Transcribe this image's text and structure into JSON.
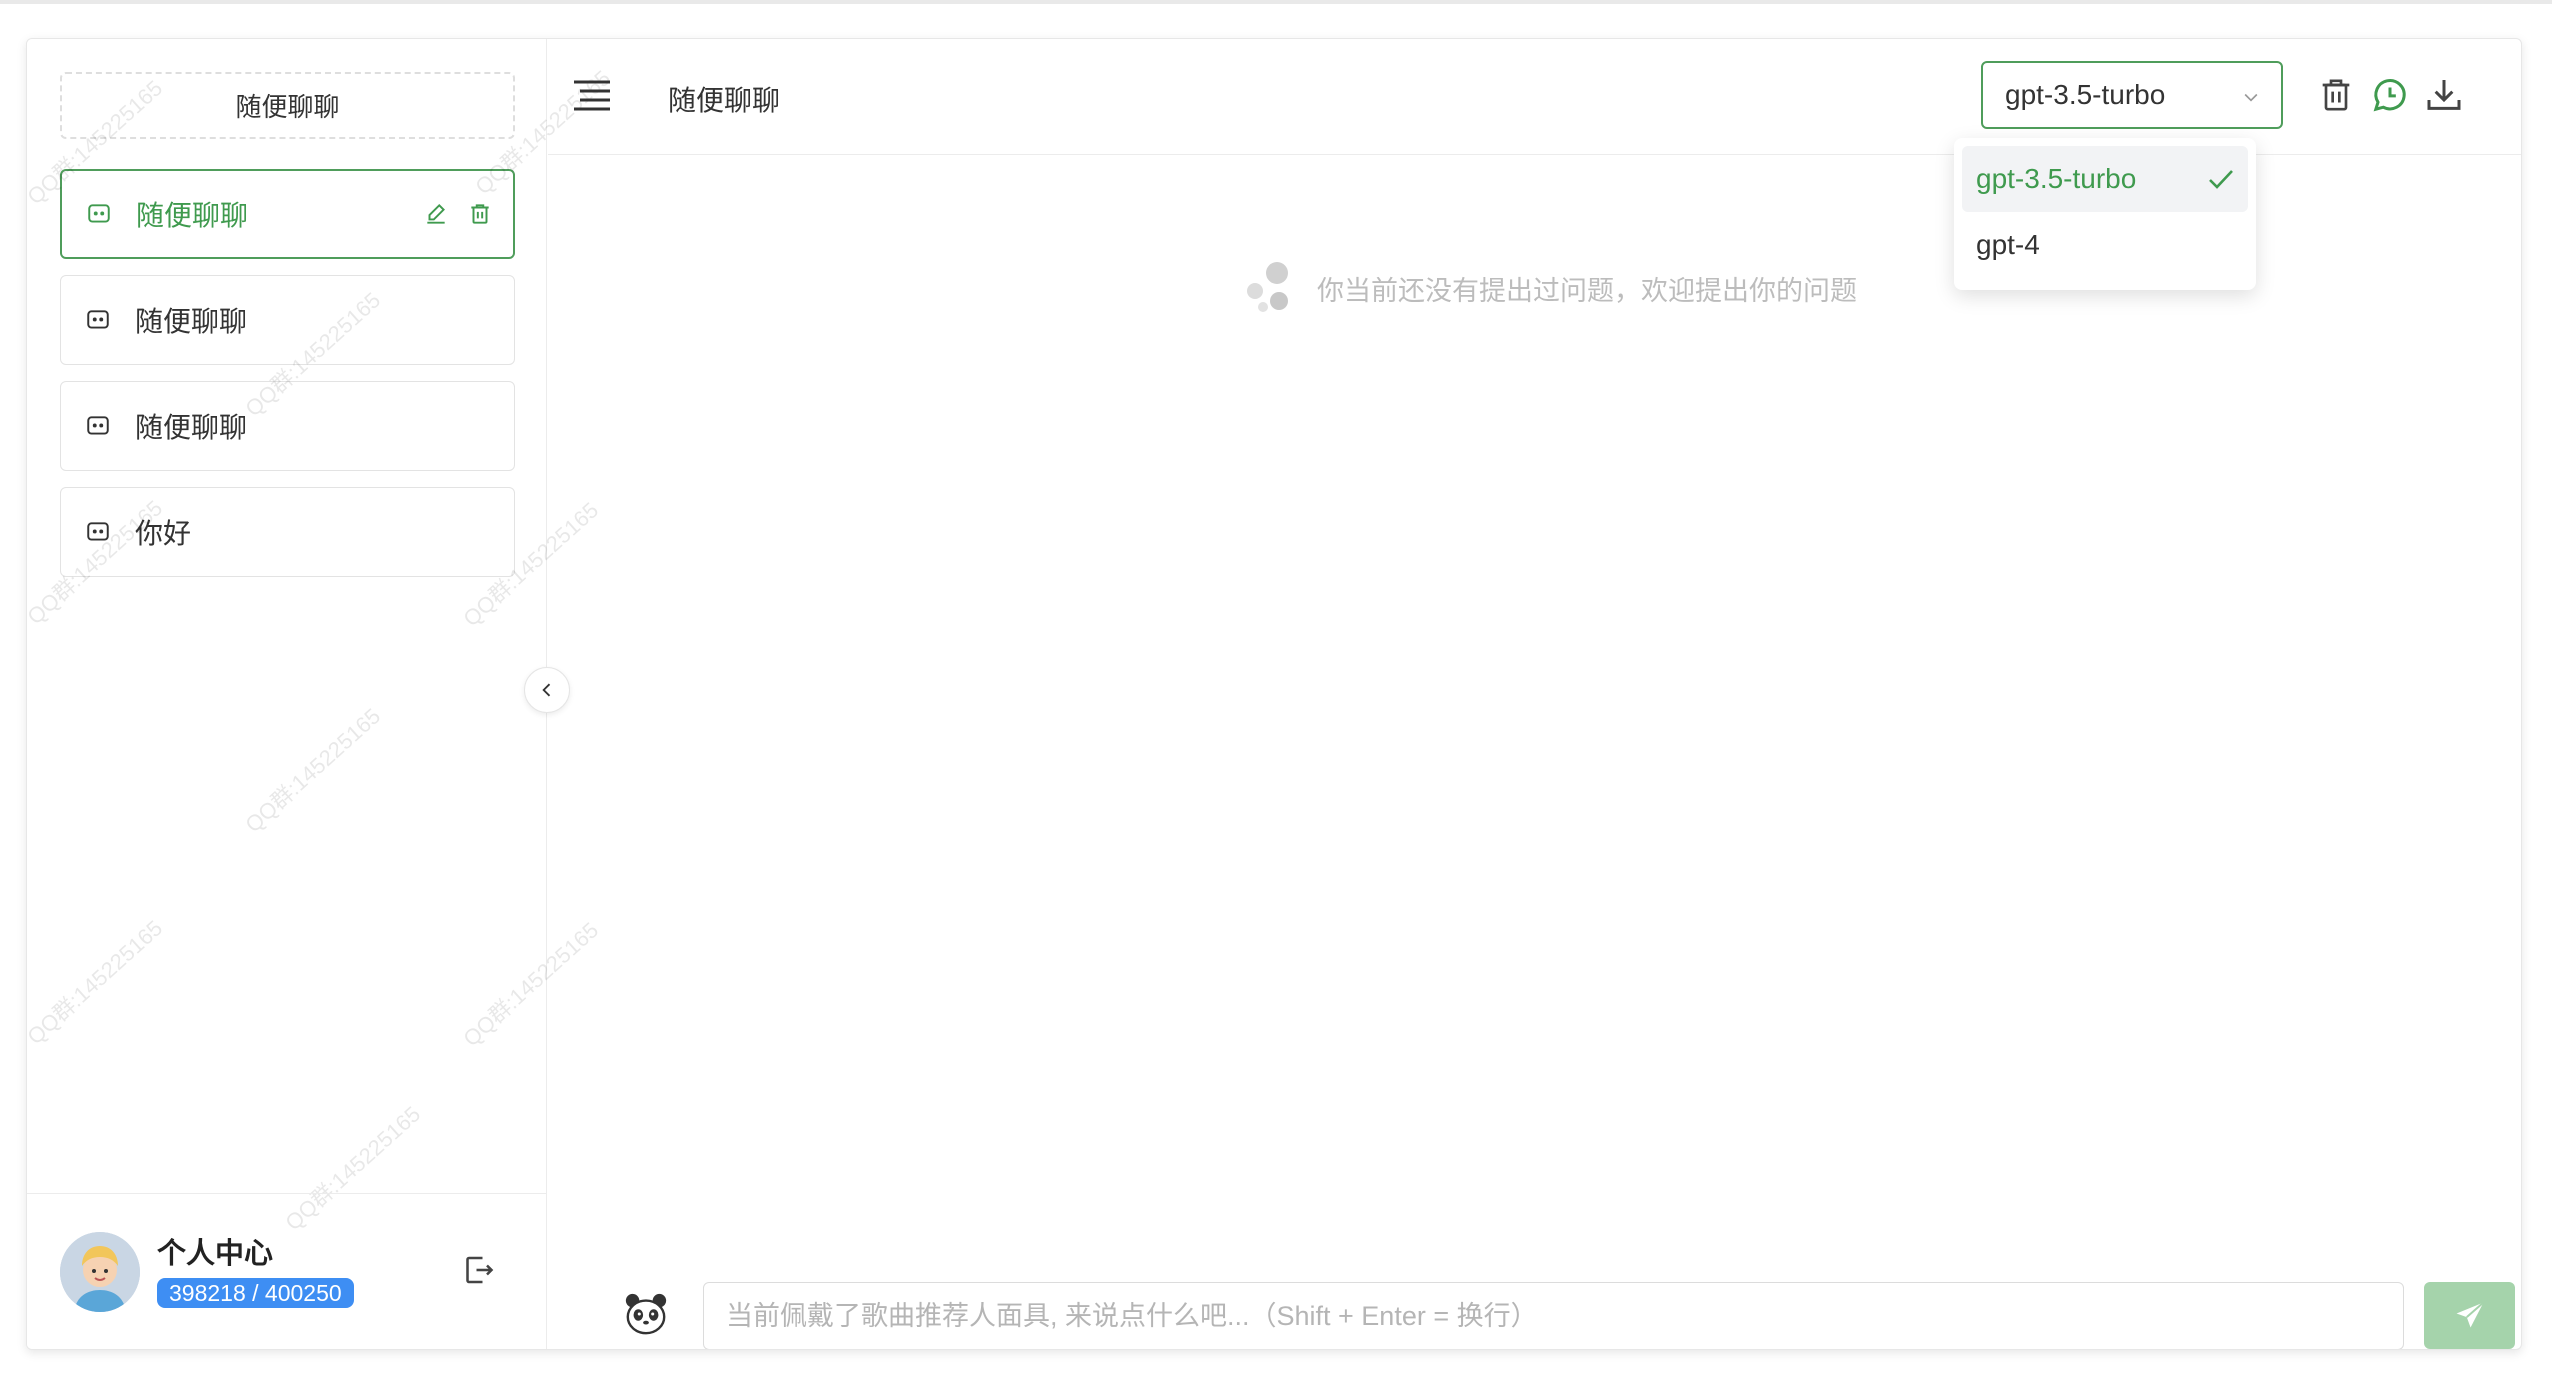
{
  "sidebar": {
    "new_chat_label": "随便聊聊",
    "chats": [
      {
        "label": "随便聊聊",
        "active": true
      },
      {
        "label": "随便聊聊",
        "active": false
      },
      {
        "label": "随便聊聊",
        "active": false
      },
      {
        "label": "你好",
        "active": false
      }
    ],
    "user": {
      "name": "个人中心",
      "quota": "398218 / 400250"
    }
  },
  "header": {
    "title": "随便聊聊",
    "model_select": {
      "value": "gpt-3.5-turbo",
      "options": [
        "gpt-3.5-turbo",
        "gpt-4"
      ],
      "selected_index": 0
    }
  },
  "main": {
    "empty_text": "你当前还没有提出过问题，欢迎提出你的问题"
  },
  "composer": {
    "placeholder": "当前佩戴了歌曲推荐人面具, 来说点什么吧...（Shift + Enter = 换行）"
  },
  "watermark": "QQ群:145225165",
  "colors": {
    "accent": "#3f9a4e",
    "quota_badge": "#3e8ef3",
    "send_button": "#a5d3ab"
  },
  "icons": {
    "chat_item": "message-square-icon",
    "edit": "pencil-icon",
    "delete": "trash-icon",
    "logout": "logout-icon",
    "menu": "menu-icon",
    "clear": "trash-icon",
    "history": "whatsapp-clock-icon",
    "download": "download-icon",
    "send": "paper-plane-icon",
    "mask": "panda-icon"
  }
}
